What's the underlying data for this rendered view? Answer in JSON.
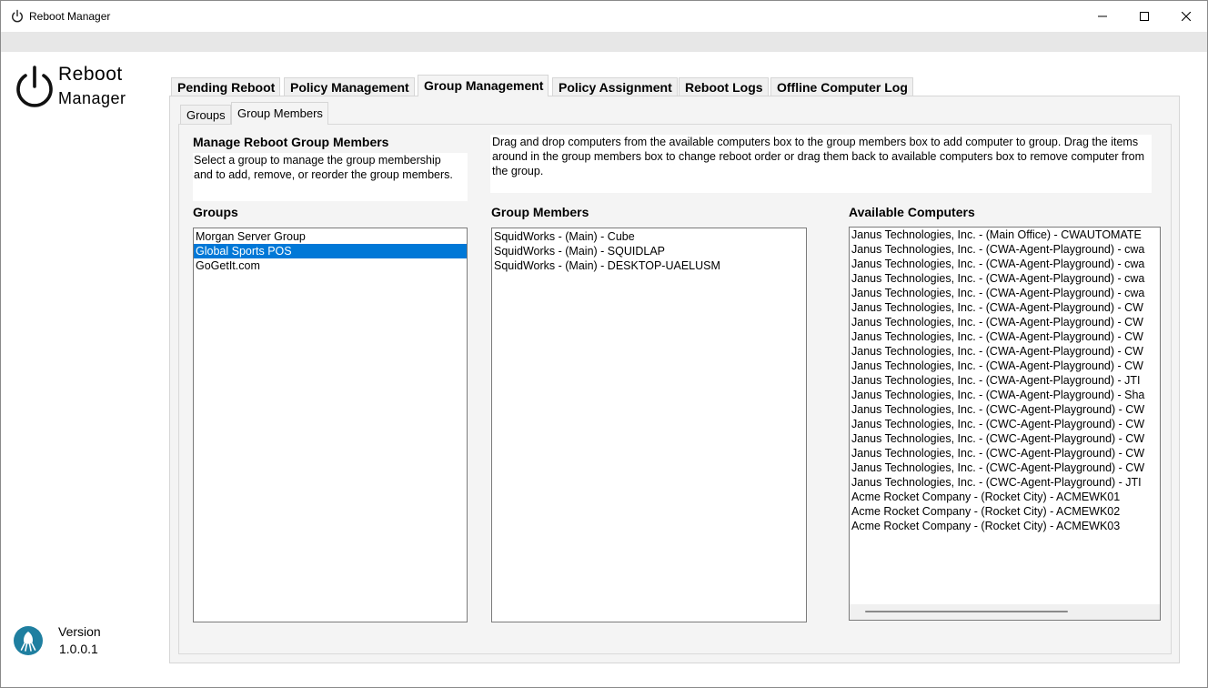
{
  "window": {
    "title": "Reboot Manager"
  },
  "logo": {
    "line1": "Reboot",
    "line2": "Manager"
  },
  "version": {
    "label": "Version",
    "value": "1.0.0.1"
  },
  "main_tabs": [
    {
      "label": "Pending Reboot",
      "active": false
    },
    {
      "label": "Policy Management",
      "active": false
    },
    {
      "label": "Group Management",
      "active": true
    },
    {
      "label": "Policy Assignment",
      "active": false
    },
    {
      "label": "Reboot Logs",
      "active": false
    },
    {
      "label": "Offline Computer Log",
      "active": false
    }
  ],
  "sub_tabs": [
    {
      "label": "Groups",
      "active": false
    },
    {
      "label": "Group Members",
      "active": true
    }
  ],
  "manage": {
    "heading": "Manage Reboot Group Members",
    "description": "Select a group to manage the group membership and to add, remove, or reorder the group members."
  },
  "instructions": "Drag and drop computers from the available computers box to the group members box to add computer to group. Drag the items around in the group members box to change reboot order or drag them back to available computers box to remove computer from the group.",
  "groups": {
    "heading": "Groups",
    "items": [
      "Morgan Server Group",
      "Global Sports POS",
      "GoGetIt.com"
    ],
    "selected_index": 1
  },
  "group_members": {
    "heading": "Group Members",
    "items": [
      "SquidWorks - (Main) - Cube",
      "SquidWorks - (Main) - SQUIDLAP",
      "SquidWorks - (Main) - DESKTOP-UAELUSM"
    ]
  },
  "available_computers": {
    "heading": "Available Computers",
    "items": [
      "Janus Technologies, Inc. - (Main Office) - CWAUTOMATE",
      "Janus Technologies, Inc. - (CWA-Agent-Playground) - cwa",
      "Janus Technologies, Inc. - (CWA-Agent-Playground) - cwa",
      "Janus Technologies, Inc. - (CWA-Agent-Playground) - cwa",
      "Janus Technologies, Inc. - (CWA-Agent-Playground) - cwa",
      "Janus Technologies, Inc. - (CWA-Agent-Playground) - CW",
      "Janus Technologies, Inc. - (CWA-Agent-Playground) - CW",
      "Janus Technologies, Inc. - (CWA-Agent-Playground) - CW",
      "Janus Technologies, Inc. - (CWA-Agent-Playground) - CW",
      "Janus Technologies, Inc. - (CWA-Agent-Playground) - CW",
      "Janus Technologies, Inc. - (CWA-Agent-Playground) - JTI",
      "Janus Technologies, Inc. - (CWA-Agent-Playground) - Sha",
      "Janus Technologies, Inc. - (CWC-Agent-Playground) - CW",
      "Janus Technologies, Inc. - (CWC-Agent-Playground) - CW",
      "Janus Technologies, Inc. - (CWC-Agent-Playground) - CW",
      "Janus Technologies, Inc. - (CWC-Agent-Playground) - CW",
      "Janus Technologies, Inc. - (CWC-Agent-Playground) - CW",
      "Janus Technologies, Inc. - (CWC-Agent-Playground) - JTI",
      "Acme Rocket Company - (Rocket City) - ACMEWK01",
      "Acme Rocket Company - (Rocket City) - ACMEWK02",
      "Acme Rocket Company - (Rocket City) - ACMEWK03"
    ]
  },
  "icons": {
    "title": "power-icon",
    "logo": "power-icon",
    "brand": "squid-icon",
    "minimize": "minimize-icon",
    "maximize": "maximize-icon",
    "close": "close-icon"
  },
  "colors": {
    "selection": "#0078d7",
    "brand_teal": "#1f7fa0"
  }
}
